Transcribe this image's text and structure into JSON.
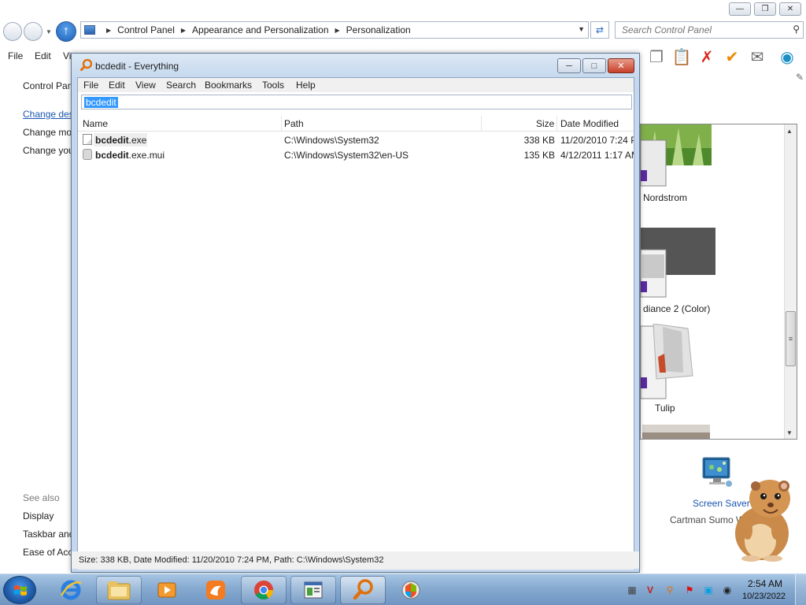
{
  "control_panel": {
    "breadcrumb": [
      "Control Panel",
      "Appearance and Personalization",
      "Personalization"
    ],
    "search_placeholder": "Search Control Panel",
    "menu": {
      "file": "File",
      "edit": "Edit",
      "view": "Vi"
    },
    "left_links": {
      "home": "Control Pan",
      "change_desktop": "Change des",
      "change_mouse": "Change mo",
      "change_account": "Change you"
    },
    "see_also": {
      "heading": "See also",
      "display": "Display",
      "taskbar": "Taskbar and",
      "ease": "Ease of Acc"
    },
    "themes": [
      {
        "name": "Nordstrom"
      },
      {
        "name": "diance 2 (Color)"
      },
      {
        "name": "Tulip"
      }
    ],
    "screen_saver_label": "Screen Saver",
    "screen_saver_value": "Cartman Sumo W"
  },
  "everything": {
    "title": "bcdedit - Everything",
    "menu": [
      "File",
      "Edit",
      "View",
      "Search",
      "Bookmarks",
      "Tools",
      "Help"
    ],
    "search_value": "bcdedit",
    "columns": {
      "name": "Name",
      "path": "Path",
      "size": "Size",
      "date": "Date Modified"
    },
    "results": [
      {
        "name_match": "bcdedit",
        "name_rest": ".exe",
        "path": "C:\\Windows\\System32",
        "size": "338 KB",
        "date": "11/20/2010 7:24 PM"
      },
      {
        "name_match": "bcdedit",
        "name_rest": ".exe.mui",
        "path": "C:\\Windows\\System32\\en-US",
        "size": "135 KB",
        "date": "4/12/2011 1:17 AM"
      }
    ],
    "status": "Size: 338 KB, Date Modified: 11/20/2010 7:24 PM, Path: C:\\Windows\\System32"
  },
  "taskbar": {
    "clock_time": "2:54 AM",
    "clock_date": "10/23/2022"
  }
}
